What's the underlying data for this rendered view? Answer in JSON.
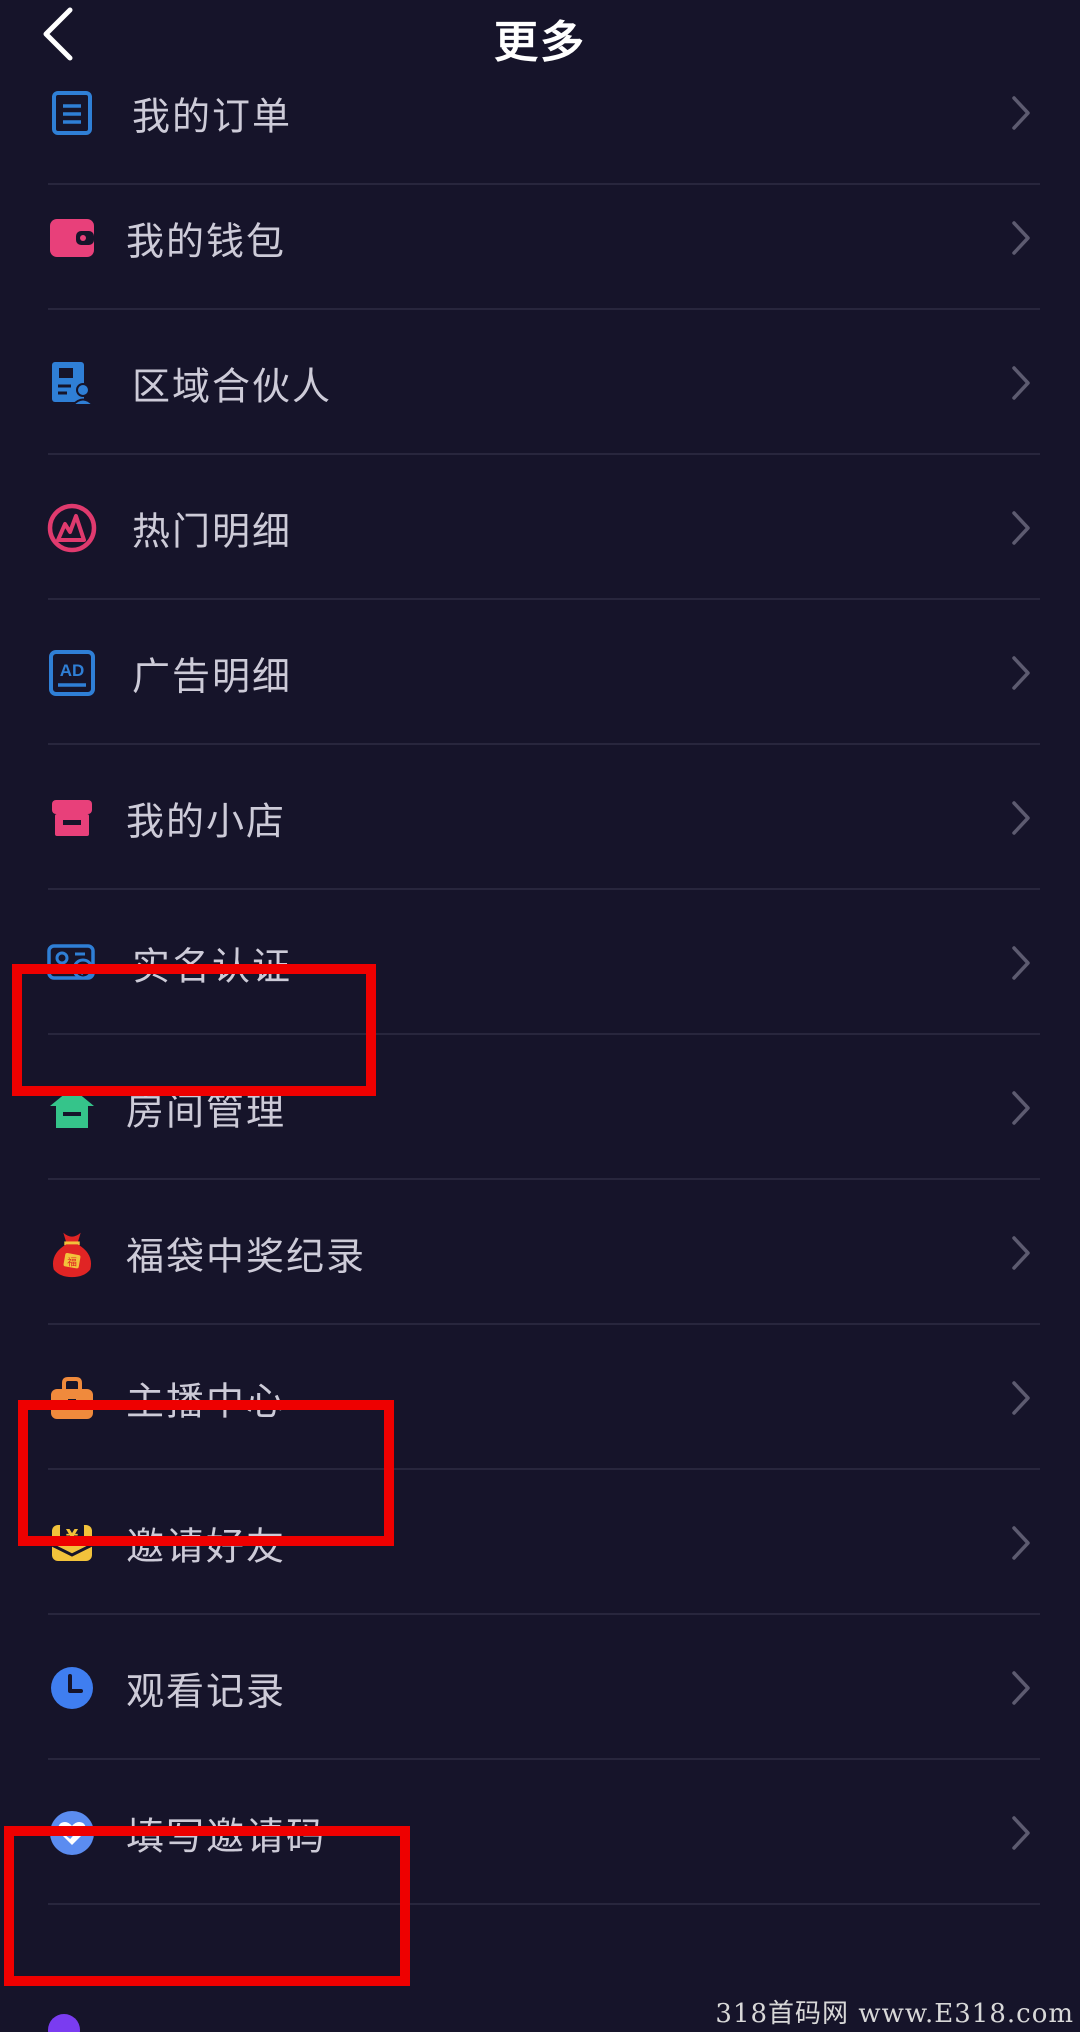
{
  "header": {
    "title": "更多",
    "back_icon": "chevron-left-icon"
  },
  "menu": {
    "items": [
      {
        "id": "orders",
        "label": "我的订单",
        "icon": "order-list-icon",
        "color": "#2f7fd6"
      },
      {
        "id": "wallet",
        "label": "我的钱包",
        "icon": "wallet-icon",
        "color": "#e8407a"
      },
      {
        "id": "regional-partner",
        "label": "区域合伙人",
        "icon": "partner-id-card-icon",
        "color": "#2f7fd6"
      },
      {
        "id": "hot-details",
        "label": "热门明细",
        "icon": "flame-circle-icon",
        "color": "#e03a6e"
      },
      {
        "id": "ad-details",
        "label": "广告明细",
        "icon": "ad-icon",
        "color": "#2f7fd6"
      },
      {
        "id": "my-shop",
        "label": "我的小店",
        "icon": "shop-icon",
        "color": "#e8407a"
      },
      {
        "id": "real-name",
        "label": "实名认证",
        "icon": "verified-id-icon",
        "color": "#2f7fd6"
      },
      {
        "id": "room-manage",
        "label": "房间管理",
        "icon": "house-icon",
        "color": "#35c48a"
      },
      {
        "id": "lucky-bag",
        "label": "福袋中奖纪录",
        "icon": "lucky-bag-icon",
        "color": "#e02424"
      },
      {
        "id": "streamer-center",
        "label": "主播中心",
        "icon": "briefcase-icon",
        "color": "#f08a3c"
      },
      {
        "id": "invite-friends",
        "label": "邀请好友",
        "icon": "yuan-envelope-icon",
        "color": "#f2c23b"
      },
      {
        "id": "watch-history",
        "label": "观看记录",
        "icon": "clock-icon",
        "color": "#3f7ef0"
      },
      {
        "id": "enter-invite-code",
        "label": "填写邀请码",
        "icon": "heart-check-icon",
        "color": "#5b8cf0"
      }
    ]
  },
  "annotations": {
    "highlight_color": "#ee0000"
  },
  "watermark": "318首码网 www.E318.com"
}
